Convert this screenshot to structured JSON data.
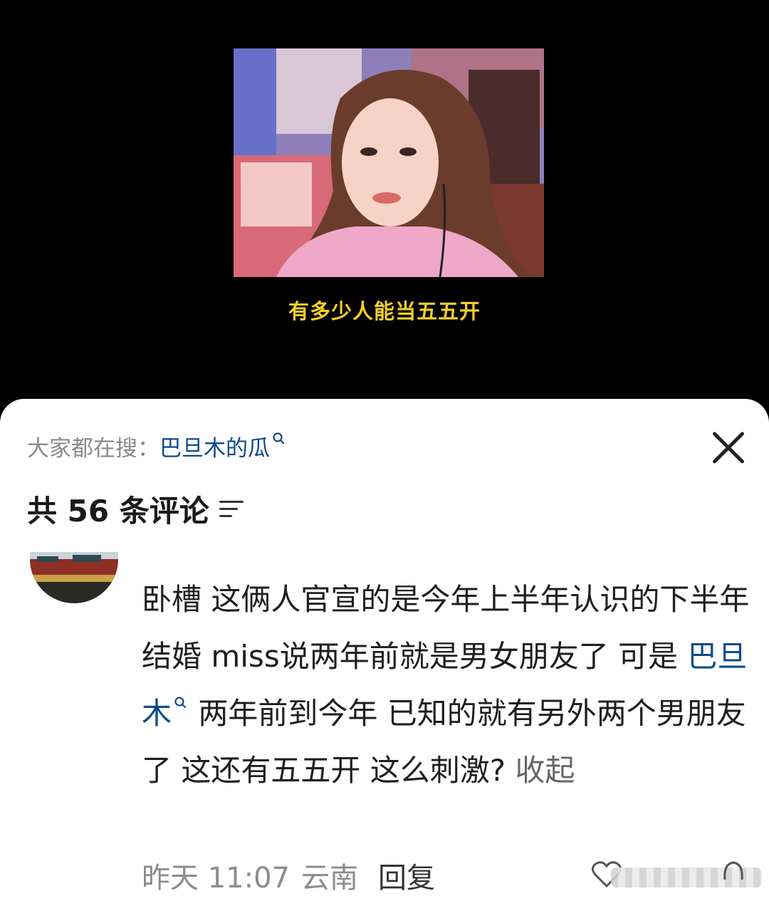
{
  "video": {
    "subtitle": "有多少人能当五五开"
  },
  "comments_panel": {
    "search_prefix": "大家都在搜：",
    "search_term": "巴旦木的瓜",
    "comment_count_title": "共 56 条评论",
    "comment": {
      "text_part1": "卧槽 这俩人官宣的是今年上半年认识的下半年结婚 miss说两年前就是男女朋友了 可是 ",
      "mention": "巴旦木",
      "text_part2": " 两年前到今年 已知的就有另外两个男朋友了 这还有五五开 这么刺激? ",
      "collapse_label": "收起",
      "timestamp": "昨天 11:07",
      "location": "云南",
      "reply_label": "回复"
    }
  },
  "colors": {
    "link_blue": "#0d4a8a",
    "subtitle_yellow": "#f2cf2a"
  }
}
